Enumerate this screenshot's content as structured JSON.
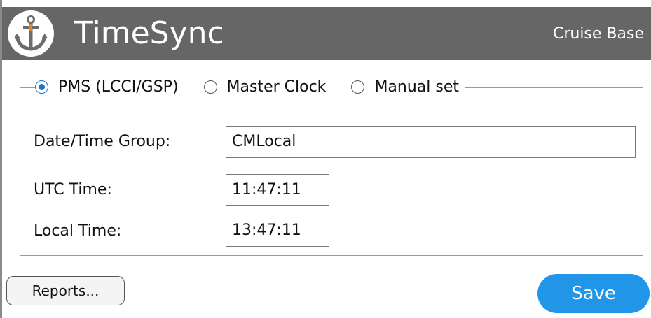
{
  "header": {
    "app_title": "TimeSync",
    "subtitle": "Cruise Base",
    "logo_icon": "anchor-icon"
  },
  "time_source": {
    "options": [
      {
        "label": "PMS (LCCI/GSP)",
        "selected": true
      },
      {
        "label": "Master Clock",
        "selected": false
      },
      {
        "label": "Manual set",
        "selected": false
      }
    ]
  },
  "fields": {
    "date_time_group": {
      "label": "Date/Time Group:",
      "value": "CMLocal"
    },
    "utc_time": {
      "label": "UTC Time:",
      "value": "11:47:11"
    },
    "local_time": {
      "label": "Local Time:",
      "value": "13:47:11"
    }
  },
  "actions": {
    "reports_label": "Reports...",
    "save_label": "Save"
  },
  "colors": {
    "titlebar": "#666666",
    "accent": "#2196e8",
    "radio_selected": "#1a73c9"
  }
}
